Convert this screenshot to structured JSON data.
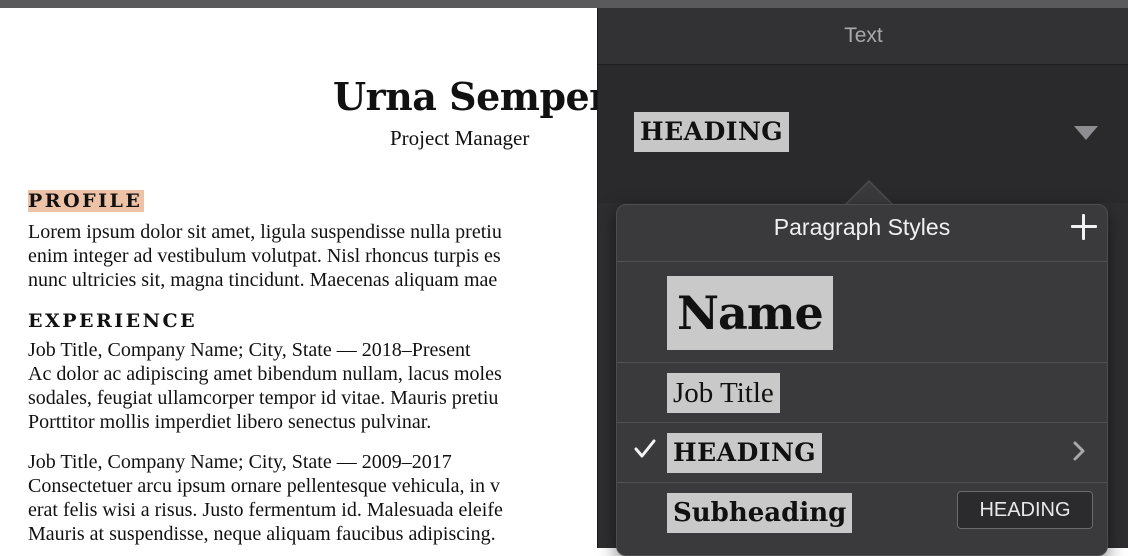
{
  "document": {
    "name": "Urna Semper",
    "job_title": "Project Manager",
    "profile_heading": "PROFILE",
    "profile_lines": [
      "Lorem ipsum dolor sit amet, ligula suspendisse nulla pretiu",
      "enim integer ad vestibulum volutpat. Nisl rhoncus turpis es",
      "nunc ultricies sit, magna tincidunt. Maecenas aliquam mae"
    ],
    "experience_heading": "EXPERIENCE",
    "job1_lines": [
      "Job Title, Company Name; City, State — 2018–Present",
      "Ac dolor ac adipiscing amet bibendum nullam, lacus moles",
      "sodales, feugiat ullamcorper tempor id vitae. Mauris pretiu",
      "Porttitor mollis imperdiet libero senectus pulvinar."
    ],
    "job2_lines": [
      "Job Title, Company Name; City, State — 2009–2017",
      "Consectetuer arcu ipsum ornare pellentesque vehicula, in v",
      "erat felis wisi a risus. Justo fermentum id. Malesuada eleife",
      "Mauris at suspendisse, neque aliquam faucibus adipiscing."
    ]
  },
  "panel": {
    "title": "Text",
    "current_style": "HEADING"
  },
  "popover": {
    "title": "Paragraph Styles",
    "styles": [
      {
        "label": "Name"
      },
      {
        "label": "Job Title"
      },
      {
        "label": "HEADING",
        "selected": true
      },
      {
        "label": "Subheading"
      }
    ],
    "tooltip": "HEADING"
  },
  "icons": [
    "plus-icon",
    "checkmark-icon",
    "chevron-right-icon",
    "dropdown-arrow-icon"
  ],
  "colors": {
    "highlight": "#eec2a6",
    "panel_bg": "#2e2e30",
    "popover_bg": "#3a3a3d",
    "chip_bg": "#c9c9c9"
  }
}
